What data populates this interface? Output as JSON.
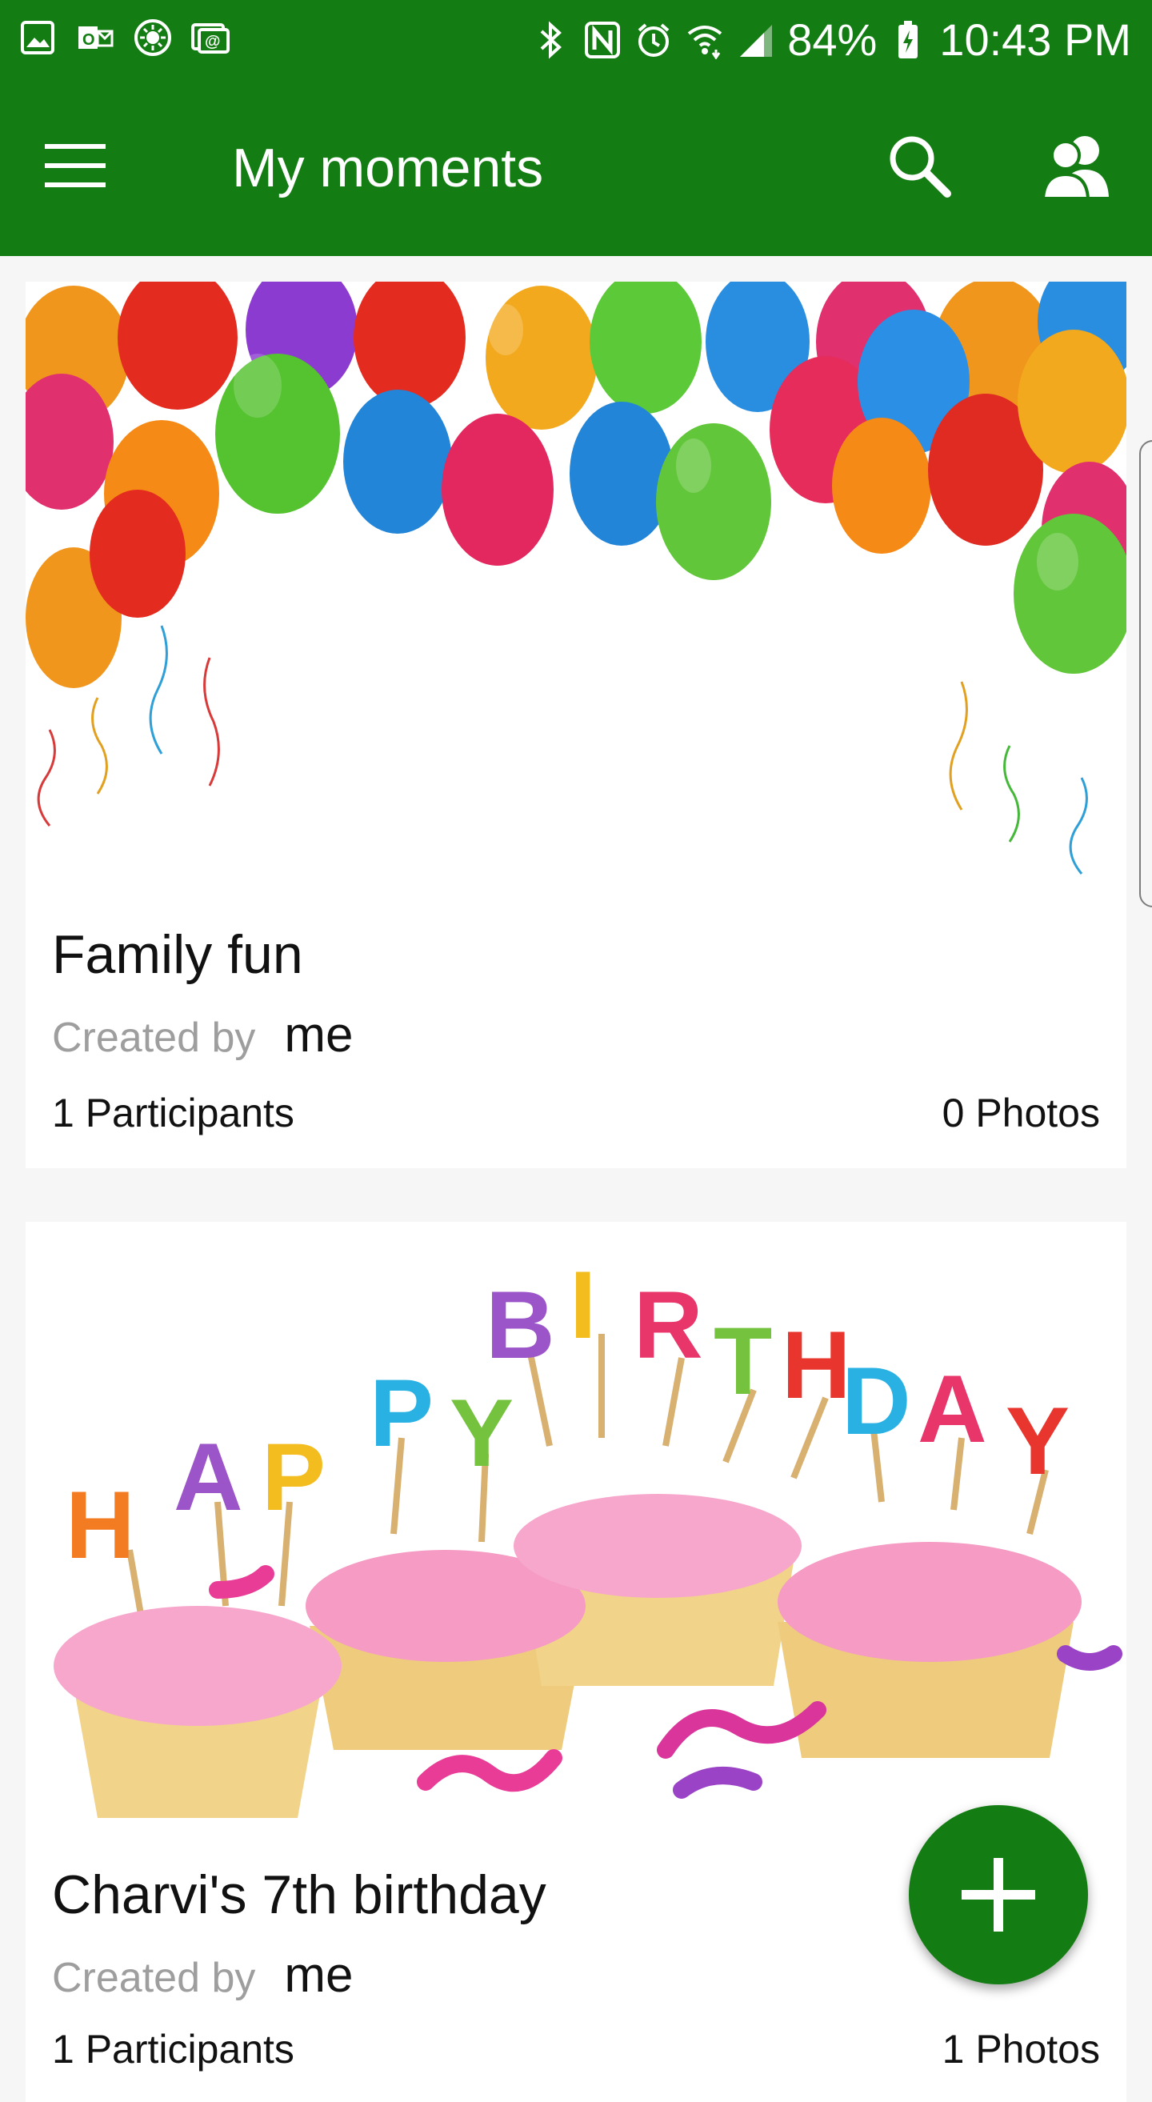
{
  "status_bar": {
    "battery": "84%",
    "time": "10:43 PM",
    "icons": [
      "gallery-icon",
      "outlook-icon",
      "sun-icon",
      "screen-mail-icon",
      "bluetooth-icon",
      "nfc-icon",
      "alarm-icon",
      "wifi-icon",
      "signal-icon",
      "battery-charging-icon"
    ]
  },
  "app_bar": {
    "title": "My moments",
    "icons": [
      "menu-icon",
      "search-icon",
      "people-icon"
    ]
  },
  "moments": [
    {
      "title": "Family fun",
      "created_label": "Created by",
      "created_by": "me",
      "participants": "1 Participants",
      "photos": "0 Photos",
      "image": "balloons-image"
    },
    {
      "title": "Charvi's 7th birthday",
      "created_label": "Created by",
      "created_by": "me",
      "participants": "1 Participants",
      "photos": "1 Photos",
      "image": "birthday-cupcakes-image"
    }
  ],
  "fab": {
    "icon": "plus-icon"
  },
  "colors": {
    "primary": "#137d13",
    "background": "#f6f6f6",
    "muted_text": "#9e9e9e"
  }
}
